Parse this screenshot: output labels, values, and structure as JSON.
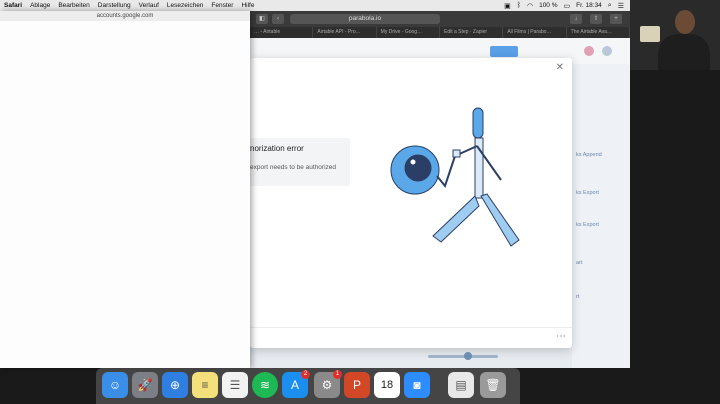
{
  "menubar": {
    "items": [
      "Safari",
      "Ablage",
      "Bearbeiten",
      "Darstellung",
      "Verlauf",
      "Lesezeichen",
      "Fenster",
      "Hilfe"
    ],
    "battery": "100 %",
    "clock": "Fr. 18:34"
  },
  "browser": {
    "url": "parabola.io",
    "tabs": [
      "… - Airtable",
      "Airtable API - Pro…",
      "My Drive - Goog…",
      "Edit a Step · Zapier",
      "All Films | Parabo…",
      "The Airtable Ava…"
    ]
  },
  "modal": {
    "error_title": "norization error",
    "error_desc": "export needs to be authorized",
    "close_icon": "close-icon",
    "more_icon": "more-icon"
  },
  "popup": {
    "title": "accounts.google.com"
  },
  "rightlist": {
    "items": [
      {
        "label": "ks Append",
        "sub": ""
      },
      {
        "label": "ks Export",
        "sub": ""
      },
      {
        "label": "ks Export",
        "sub": ""
      },
      {
        "label": "art",
        "sub": ""
      },
      {
        "label": "rt",
        "sub": ""
      }
    ]
  },
  "dock": {
    "badges": {
      "appstore": "2",
      "settings": "1"
    },
    "calendar_day": "18"
  },
  "colors": {
    "accent": "#5aa0e8",
    "robot": "#5aa8e8"
  }
}
